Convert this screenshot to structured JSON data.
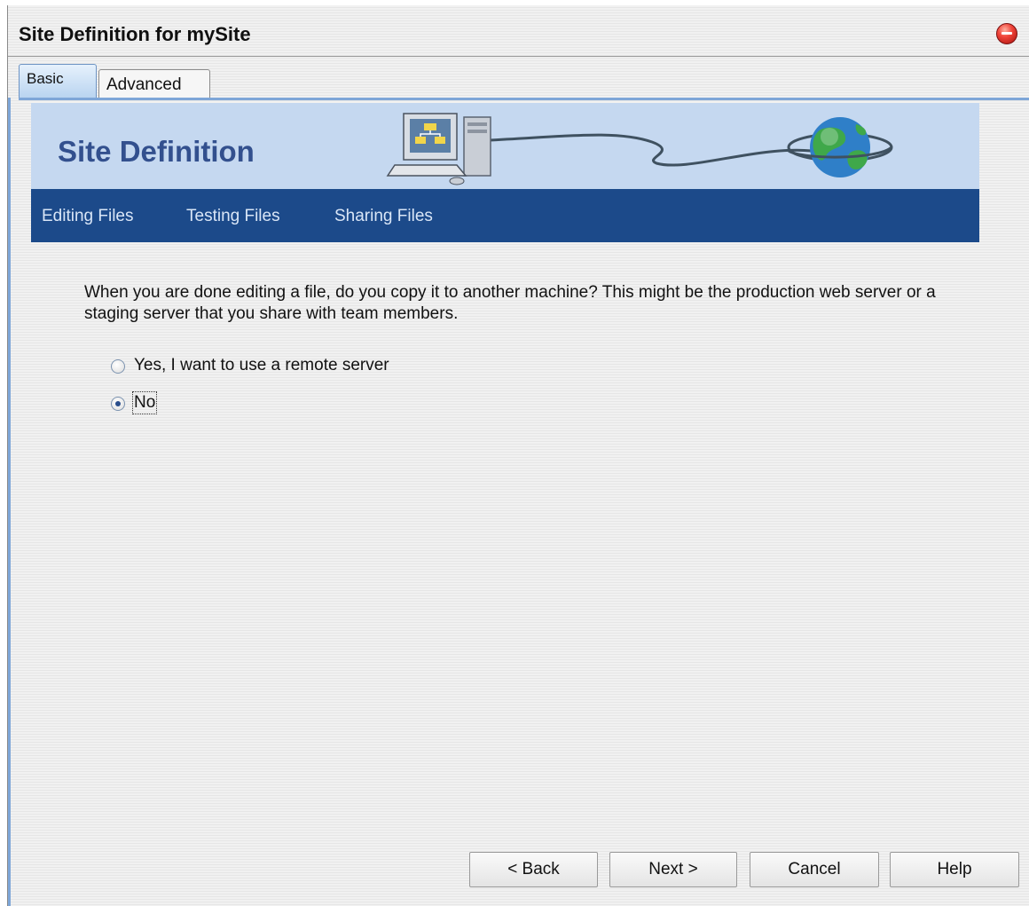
{
  "window": {
    "title": "Site Definition for mySite"
  },
  "tabs": [
    {
      "label": "Basic",
      "selected": true
    },
    {
      "label": "Advanced",
      "selected": false
    }
  ],
  "banner": {
    "title": "Site Definition"
  },
  "nav": {
    "items": [
      "Editing Files",
      "Testing Files",
      "Sharing Files"
    ]
  },
  "question": {
    "text": "When you are done editing a file, do you copy it to another machine? This might be the production web server or a staging server that you share with team members."
  },
  "options": [
    {
      "label": "Yes, I want to use a remote server",
      "selected": false
    },
    {
      "label": "No",
      "selected": true
    }
  ],
  "buttons": {
    "back": "< Back",
    "next": "Next >",
    "cancel": "Cancel",
    "help": "Help"
  },
  "colors": {
    "nav_bar": "#1c4a8a",
    "banner_bg": "#c5d8f0",
    "banner_title": "#33508e",
    "close_button": "#f0443a"
  },
  "icons": {
    "close": "close-circle-icon",
    "computer": "computer-icon",
    "globe": "globe-icon"
  }
}
